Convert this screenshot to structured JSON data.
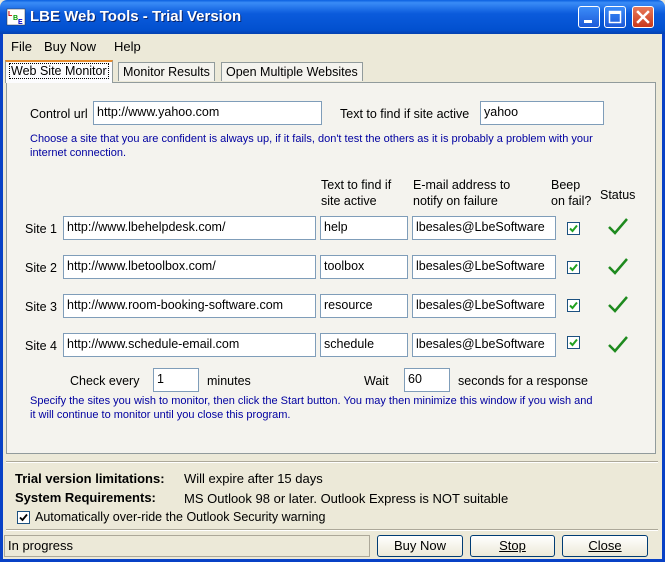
{
  "window": {
    "title": "LBE Web Tools - Trial Version"
  },
  "menu": [
    "File",
    "Buy Now",
    "Help"
  ],
  "tabs": [
    "Web Site Monitor",
    "Monitor Results",
    "Open Multiple Websites"
  ],
  "control": {
    "url_label": "Control url",
    "url_value": "http://www.yahoo.com",
    "text_label": "Text to find if site active",
    "text_value": "yahoo",
    "hint_line1": "Choose a site that you are confident is always up, if it fails, don't test the others as it is probably a problem with your",
    "hint_line2": "internet connection."
  },
  "headers": {
    "text_line1": "Text to find if",
    "text_line2": "site active",
    "email_line1": "E-mail address to",
    "email_line2": "notify on failure",
    "beep_line1": "Beep",
    "beep_line2": "on fail?",
    "status": "Status"
  },
  "sites": [
    {
      "label": "Site 1",
      "url": "http://www.lbehelpdesk.com/",
      "text": "help",
      "email": "lbesales@LbeSoftware",
      "beep": true,
      "status": "ok"
    },
    {
      "label": "Site 2",
      "url": "http://www.lbetoolbox.com/",
      "text": "toolbox",
      "email": "lbesales@LbeSoftware",
      "beep": true,
      "status": "ok"
    },
    {
      "label": "Site 3",
      "url": "http://www.room-booking-software.com",
      "text": "resource",
      "email": "lbesales@LbeSoftware",
      "beep": true,
      "status": "ok"
    },
    {
      "label": "Site 4",
      "url": "http://www.schedule-email.com",
      "text": "schedule",
      "email": "lbesales@LbeSoftware",
      "beep": true,
      "status": "ok"
    }
  ],
  "timing": {
    "check_label": "Check every",
    "check_value": "1",
    "check_unit": "minutes",
    "wait_label": "Wait",
    "wait_value": "60",
    "wait_unit": "seconds for a response"
  },
  "instructions": {
    "line1": "Specify the sites you wish to monitor, then click the Start button. You may then minimize this window if you wish and",
    "line2": "it will continue to monitor until you close this program."
  },
  "trial": {
    "label": "Trial version limitations:",
    "value": "Will expire after 15 days"
  },
  "requirements": {
    "label": "System Requirements:",
    "value": "MS Outlook 98 or later. Outlook Express is NOT suitable"
  },
  "override": {
    "label": "Automatically over-ride the Outlook Security warning",
    "checked": true
  },
  "statusbar": {
    "text": "In progress"
  },
  "buttons": {
    "buy": "Buy Now",
    "stop": "Stop",
    "close": "Close"
  },
  "colors": {
    "titlebar": "#0a5fe0",
    "hint_text": "#0000a0",
    "ok_check": "#1e8a1e"
  }
}
